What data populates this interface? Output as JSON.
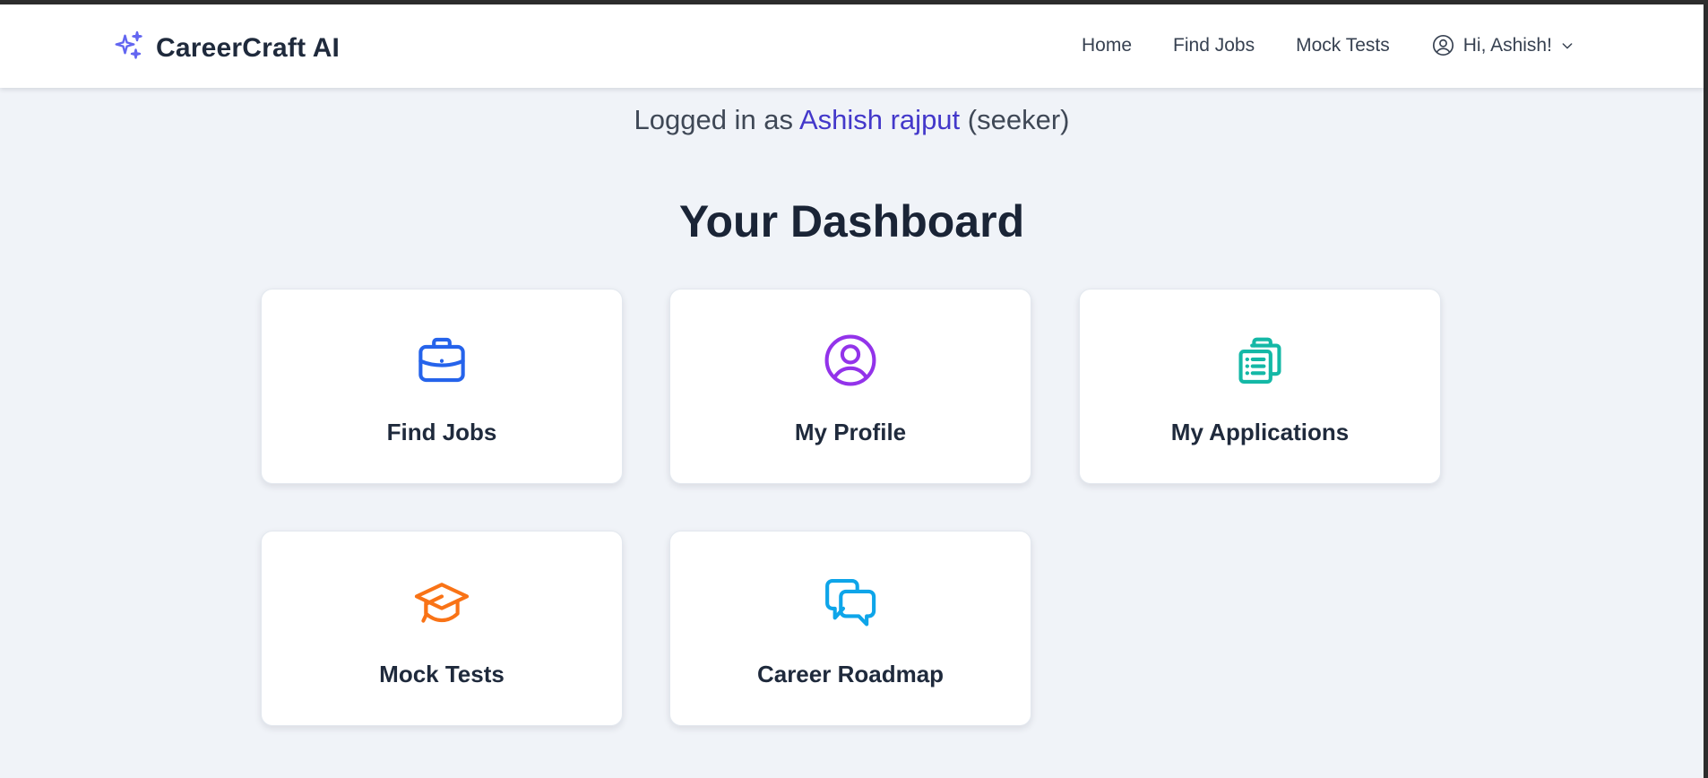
{
  "header": {
    "brand": "CareerCraft AI",
    "nav": {
      "home": "Home",
      "find_jobs": "Find Jobs",
      "mock_tests": "Mock Tests",
      "user_greeting": "Hi, Ashish!"
    }
  },
  "status": {
    "prefix": "Logged in as",
    "user_name": "Ashish rajput",
    "role": "(seeker)"
  },
  "dashboard": {
    "title": "Your Dashboard",
    "cards": [
      {
        "label": "Find Jobs",
        "icon": "briefcase-icon",
        "color": "#2563eb"
      },
      {
        "label": "My Profile",
        "icon": "user-circle-icon",
        "color": "#9333ea"
      },
      {
        "label": "My Applications",
        "icon": "clipboard-list-icon",
        "color": "#14b8a6"
      },
      {
        "label": "Mock Tests",
        "icon": "graduation-cap-icon",
        "color": "#f97316"
      },
      {
        "label": "Career Roadmap",
        "icon": "chat-bubbles-icon",
        "color": "#0ea5e9"
      }
    ]
  },
  "colors": {
    "brand_icon": "#6366f1",
    "username": "#4338ca",
    "background": "#f0f3f8"
  }
}
